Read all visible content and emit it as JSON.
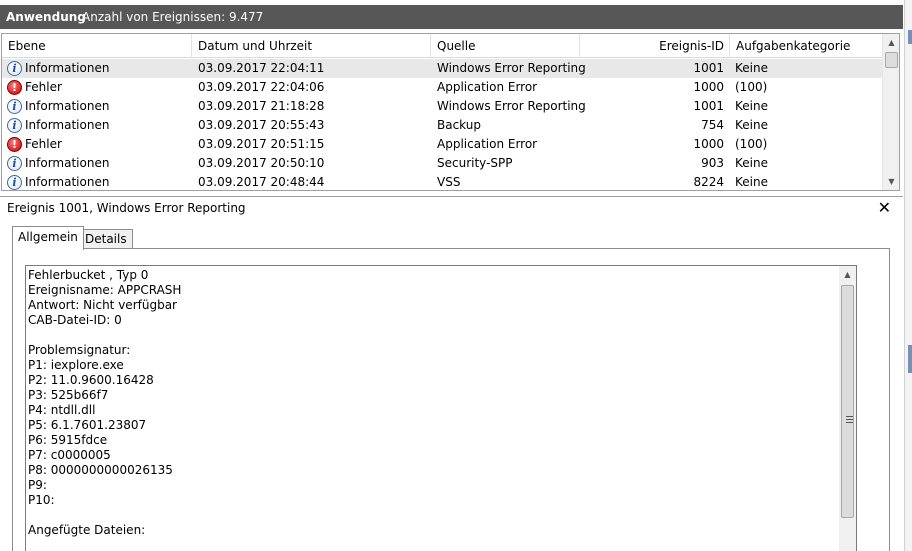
{
  "header": {
    "log_name": "Anwendung",
    "count_text": "Anzahl von Ereignissen: 9.477"
  },
  "columns": {
    "level": "Ebene",
    "date": "Datum und Uhrzeit",
    "source": "Quelle",
    "event_id": "Ereignis-ID",
    "task": "Aufgabenkategorie"
  },
  "events": [
    {
      "icon": "info-icon",
      "level": "Informationen",
      "date": "03.09.2017 22:04:11",
      "source": "Windows Error Reporting",
      "id": "1001",
      "task": "Keine"
    },
    {
      "icon": "error-icon",
      "level": "Fehler",
      "date": "03.09.2017 22:04:06",
      "source": "Application Error",
      "id": "1000",
      "task": "(100)"
    },
    {
      "icon": "info-icon",
      "level": "Informationen",
      "date": "03.09.2017 21:18:28",
      "source": "Windows Error Reporting",
      "id": "1001",
      "task": "Keine"
    },
    {
      "icon": "info-icon",
      "level": "Informationen",
      "date": "03.09.2017 20:55:43",
      "source": "Backup",
      "id": "754",
      "task": "Keine"
    },
    {
      "icon": "error-icon",
      "level": "Fehler",
      "date": "03.09.2017 20:51:15",
      "source": "Application Error",
      "id": "1000",
      "task": "(100)"
    },
    {
      "icon": "info-icon",
      "level": "Informationen",
      "date": "03.09.2017 20:50:10",
      "source": "Security-SPP",
      "id": "903",
      "task": "Keine"
    },
    {
      "icon": "info-icon",
      "level": "Informationen",
      "date": "03.09.2017 20:48:44",
      "source": "VSS",
      "id": "8224",
      "task": "Keine"
    }
  ],
  "detail": {
    "title": "Ereignis 1001, Windows Error Reporting",
    "close_glyph": "✕",
    "tabs": [
      "Allgemein",
      "Details"
    ],
    "lines": [
      "Fehlerbucket , Typ 0",
      "Ereignisname: APPCRASH",
      "Antwort: Nicht verfügbar",
      "CAB-Datei-ID: 0",
      "",
      "Problemsignatur:",
      "P1: iexplore.exe",
      "P2: 11.0.9600.16428",
      "P3: 525b66f7",
      "P4: ntdll.dll",
      "P5: 6.1.7601.23807",
      "P6: 5915fdce",
      "P7: c0000005",
      "P8: 0000000000026135",
      "P9:",
      "P10:",
      "",
      "Angefügte Dateien:"
    ]
  },
  "glyphs": {
    "up": "▲",
    "down": "▼",
    "info": "i",
    "error": "!"
  }
}
